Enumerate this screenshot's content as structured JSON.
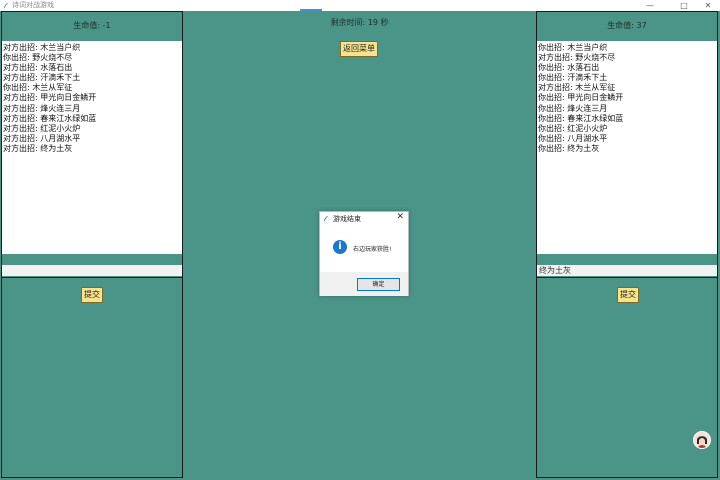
{
  "window": {
    "title": "诗词对战游戏",
    "icon": "feather-icon",
    "minimize_label": "—",
    "maximize_label": "□",
    "close_label": "✕"
  },
  "left_panel": {
    "hp_label": "生命值: -1",
    "log": [
      "对方出招: 木兰当户织",
      "你出招: 野火烧不尽",
      "对方出招: 水落石出",
      "对方出招: 汗滴禾下土",
      "你出招: 木兰从军征",
      "对方出招: 甲光向日金鳞开",
      "对方出招: 烽火连三月",
      "对方出招: 春来江水绿如蓝",
      "对方出招: 红泥小火炉",
      "对方出招: 八月湖水平",
      "对方出招: 终为土灰"
    ],
    "answer_value": "",
    "submit_label": "提交"
  },
  "center": {
    "timer_label": "剩余时间: 19 秒",
    "menu_button_label": "返回菜单"
  },
  "right_panel": {
    "hp_label": "生命值: 37",
    "log": [
      "你出招: 木兰当户织",
      "对方出招: 野火烧不尽",
      "你出招: 水落石出",
      "你出招: 汗滴禾下土",
      "对方出招: 木兰从军征",
      "你出招: 甲光向日金鳞开",
      "你出招: 烽火连三月",
      "你出招: 春来江水绿如蓝",
      "你出招: 红泥小火炉",
      "你出招: 八月湖水平",
      "你出招: 终为土灰"
    ],
    "answer_value": "终为土灰",
    "submit_label": "提交"
  },
  "dialog": {
    "title": "游戏结束",
    "message": "右边玩家获胜!",
    "ok_label": "确定",
    "close_label": "✕",
    "icon": "info-icon"
  },
  "colors": {
    "background": "#4a9488",
    "button": "#f6e38b",
    "info": "#1976d2"
  }
}
